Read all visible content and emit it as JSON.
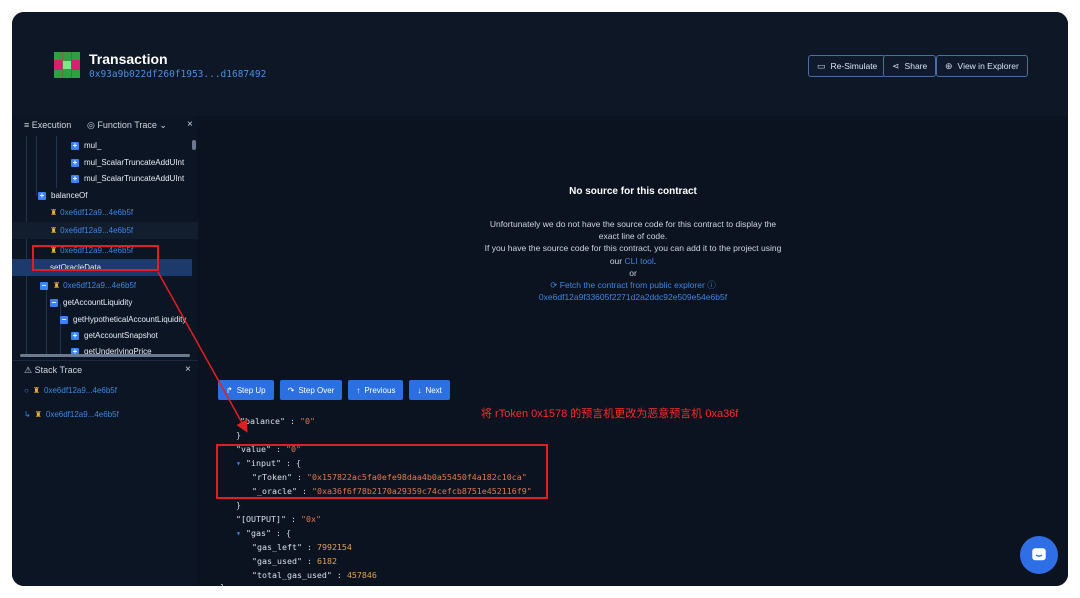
{
  "header": {
    "title": "Transaction",
    "hash": "0x93a9b022df260f1953...d1687492",
    "buttons": {
      "resimulate": "Re-Simulate",
      "share": "Share",
      "explorer": "View in Explorer"
    }
  },
  "left_panel": {
    "tabs": {
      "execution": "Execution",
      "function_trace": "Function Trace"
    },
    "tree": [
      {
        "label": "mul_",
        "kind": "fn"
      },
      {
        "label": "mul_ScalarTruncateAddUInt",
        "kind": "fn"
      },
      {
        "label": "mul_ScalarTruncateAddUInt",
        "kind": "fn"
      },
      {
        "label": "balanceOf",
        "kind": "fn"
      },
      {
        "label": "0xe6df12a9...4e6b5f",
        "kind": "addr"
      },
      {
        "label": "0xe6df12a9...4e6b5f",
        "kind": "addr"
      },
      {
        "label": "0xe6df12a9...4e6b5f",
        "kind": "addr"
      },
      {
        "label": "setOracleData",
        "kind": "fn"
      },
      {
        "label": "0xe6df12a9...4e6b5f",
        "kind": "addr"
      },
      {
        "label": "getAccountLiquidity",
        "kind": "fn"
      },
      {
        "label": "getHypotheticalAccountLiquidity",
        "kind": "fn"
      },
      {
        "label": "getAccountSnapshot",
        "kind": "fn"
      },
      {
        "label": "getUnderlyingPrice",
        "kind": "fn"
      }
    ],
    "stack_trace": {
      "title": "Stack Trace",
      "items": [
        "0xe6df12a9...4e6b5f",
        "0xe6df12a9...4e6b5f"
      ]
    }
  },
  "main": {
    "no_source_title": "No source for this contract",
    "no_source_line1": "Unfortunately we do not have the source code for this contract to display the exact line of code.",
    "no_source_line2": "If you have the source code for this contract, you can add it to the project using our",
    "cli_link": "CLI tool",
    "cli_suffix": ".",
    "or": "or",
    "fetch_link": "Fetch the contract from public explorer",
    "contract_address": "0xe6df12a9f33605f2271d2a2ddc92e509e54e6b5f",
    "step_buttons": {
      "step_up": "Step Up",
      "step_over": "Step Over",
      "previous": "Previous",
      "next": "Next"
    },
    "annotation": "将 rToken 0x1578 的预言机更改为恶意预言机 0xa36f",
    "code": {
      "balance_key": "\"balance\"",
      "balance_val": "\"0\"",
      "value_key": "\"value\"",
      "value_val": "\"0\"",
      "input_key": "\"input\"",
      "rtoken_key": "\"rToken\"",
      "rtoken_val": "\"0x157822ac5fa0efe98daa4b0a55450f4a182c10ca\"",
      "oracle_key": "\"_oracle\"",
      "oracle_val": "\"0xa36f6f78b2170a29359c74cefcb8751e452116f9\"",
      "output_key": "\"[OUTPUT]\"",
      "output_val": "\"0x\"",
      "gas_key": "\"gas\"",
      "gas_left_key": "\"gas_left\"",
      "gas_left_val": "7992154",
      "gas_used_key": "\"gas_used\"",
      "gas_used_val": "6182",
      "total_gas_key": "\"total_gas_used\"",
      "total_gas_val": "457846"
    }
  },
  "colors": {
    "background": "#0b1320",
    "accent": "#2c6fe0",
    "link": "#3f86e0",
    "annotation_red": "#e02020"
  }
}
